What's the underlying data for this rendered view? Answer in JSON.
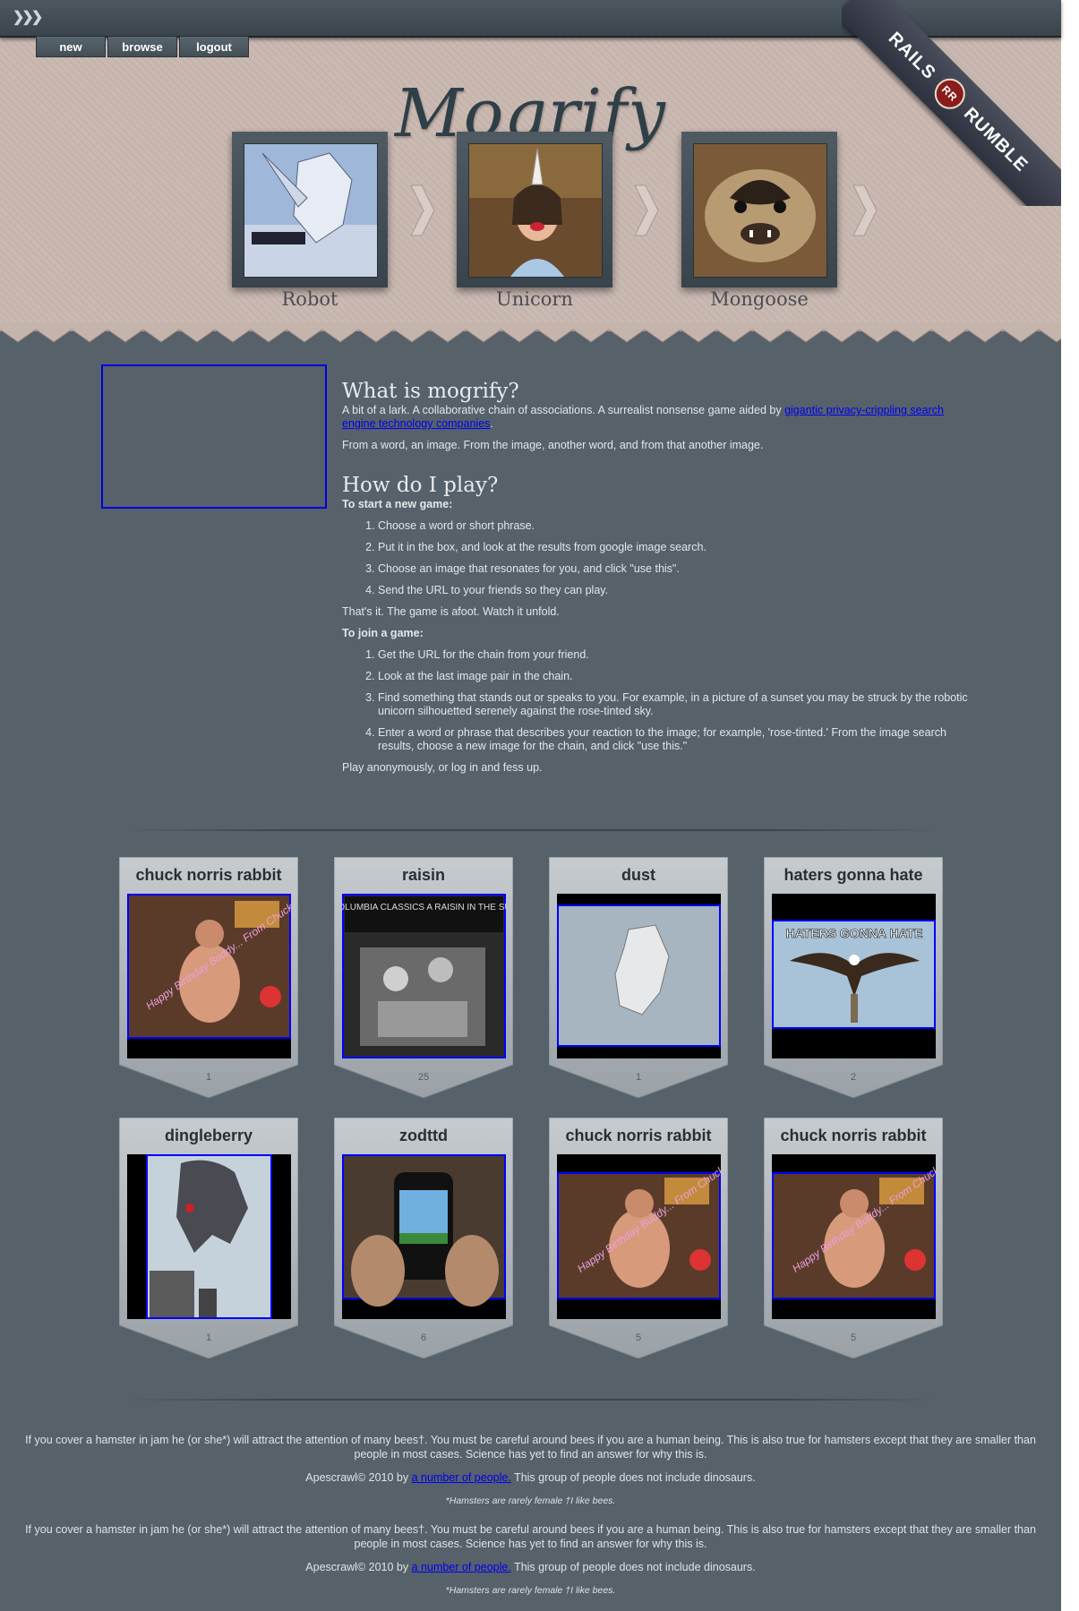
{
  "topbar": {
    "menu_icon": "❯❯❯"
  },
  "nav": {
    "items": [
      "new",
      "browse",
      "logout"
    ]
  },
  "logo": "Mogrify",
  "ribbon": {
    "left": "RAILS",
    "badge": "RR",
    "right": "RUMBLE"
  },
  "hero": [
    {
      "label": "Robot"
    },
    {
      "label": "Unicorn"
    },
    {
      "label": "Mongoose"
    }
  ],
  "intro": {
    "heading_what": "What is mogrify?",
    "p1_text": "A bit of a lark. A collaborative chain of associations. A surrealist nonsense game aided by",
    "p1_link": "gigantic privacy-crippling search engine technology companies",
    "p1_end": ".",
    "p2": "From a word, an image. From the image, another word, and from that another image.",
    "heading_how": "How do I play?",
    "start_title": "To start a new game:",
    "start_steps": [
      "Choose a word or short phrase.",
      "Put it in the box, and look at the results from google image search.",
      "Choose an image that resonates for you, and click \"use this\".",
      "Send the URL to your friends so they can play."
    ],
    "afoot": "That's it. The game is afoot. Watch it unfold.",
    "join_title": "To join a game:",
    "join_steps": [
      "Get the URL for the chain from your friend.",
      "Look at the last image pair in the chain.",
      "Find something that stands out or speaks to you. For example, in a picture of a sunset you may be struck by the robotic unicorn silhouetted serenely against the rose-tinted sky.",
      "Enter a word or phrase that describes your reaction to the image; for example, 'rose-tinted.' From the image search results, choose a new image for the chain, and click \"use this.\""
    ],
    "anon": "Play anonymously, or log in and fess up."
  },
  "cards": [
    {
      "title": "chuck norris rabbit",
      "count": "1",
      "caption": "Happy Birthday Buddy... From Chuck"
    },
    {
      "title": "raisin",
      "count": "25",
      "caption": "COLUMBIA CLASSICS  A RAISIN IN THE SUN"
    },
    {
      "title": "dust",
      "count": "1",
      "caption": ""
    },
    {
      "title": "haters gonna hate",
      "count": "2",
      "caption": "HATERS GONNA HATE"
    },
    {
      "title": "dingleberry",
      "count": "1",
      "caption": ""
    },
    {
      "title": "zodttd",
      "count": "6",
      "caption": ""
    },
    {
      "title": "chuck norris rabbit",
      "count": "5",
      "caption": "Happy Birthday Buddy... From Chuck"
    },
    {
      "title": "chuck norris rabbit",
      "count": "5",
      "caption": "Happy Birthday Buddy... From Chuck"
    }
  ],
  "footer": {
    "hamster": "If you cover a hamster in jam he (or she*) will attract the attention of many bees†. You must be careful around bees if you are a human being. This is also true for hamsters except that they are smaller than people in most cases. Science has yet to find an answer for why this is.",
    "copyright_pre": "Apescrawl© 2010 by",
    "copyright_link": "a number of people.",
    "copyright_post": "This group of people does not include dinosaurs.",
    "note": "*Hamsters are rarely female †I like bees."
  }
}
